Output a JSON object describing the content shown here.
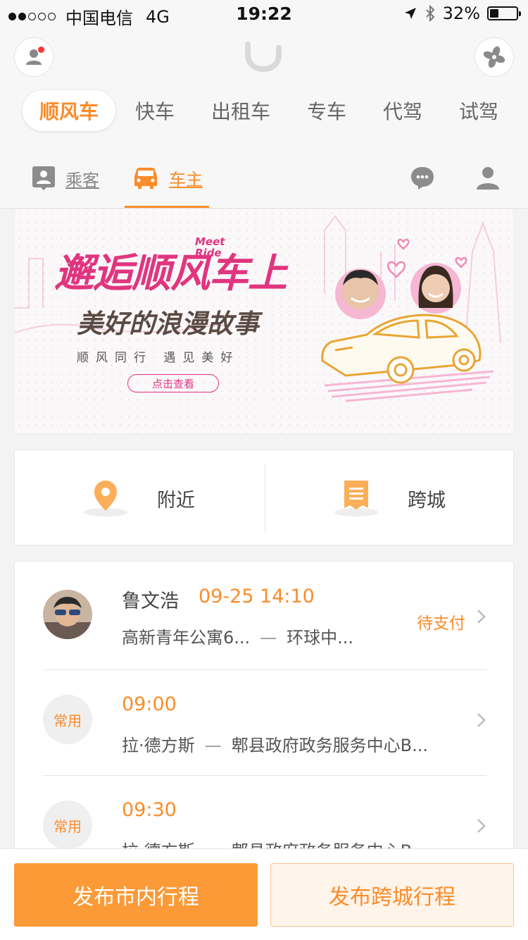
{
  "status_bar": {
    "carrier": "中国电信",
    "network": "4G",
    "time": "19:22",
    "battery": "32%",
    "battery_level": 0.32
  },
  "service_tabs": [
    {
      "label": "顺风车",
      "active": true
    },
    {
      "label": "快车"
    },
    {
      "label": "出租车"
    },
    {
      "label": "专车"
    },
    {
      "label": "代驾"
    },
    {
      "label": "试驾"
    }
  ],
  "role_tabs": {
    "passenger": "乘客",
    "driver": "车主",
    "active": "driver"
  },
  "banner": {
    "title": "邂逅顺风车上",
    "meet": "Meet",
    "ride": "Ride",
    "subtitle": "美好的浪漫故事",
    "tagline": "顺风同行   遇见美好",
    "cta": "点击查看"
  },
  "modes": {
    "nearby": "附近",
    "intercity": "跨城"
  },
  "trips": [
    {
      "name": "鲁文浩",
      "time": "09-25 14:10",
      "from": "高新青年公寓6...",
      "to": "环球中...",
      "status": "待支付",
      "type": "order"
    },
    {
      "badge": "常用",
      "time": "09:00",
      "from": "拉·德方斯",
      "to": "郫县政府政务服务中心B...",
      "type": "common"
    },
    {
      "badge": "常用",
      "time": "09:30",
      "from": "拉·德方斯",
      "to": "郫县政府政务服务中心B...",
      "type": "common"
    }
  ],
  "bottom": {
    "publish_city": "发布市内行程",
    "publish_intercity": "发布跨城行程"
  },
  "colors": {
    "accent": "#fa8c2b",
    "banner_pink": "#e0357f"
  }
}
